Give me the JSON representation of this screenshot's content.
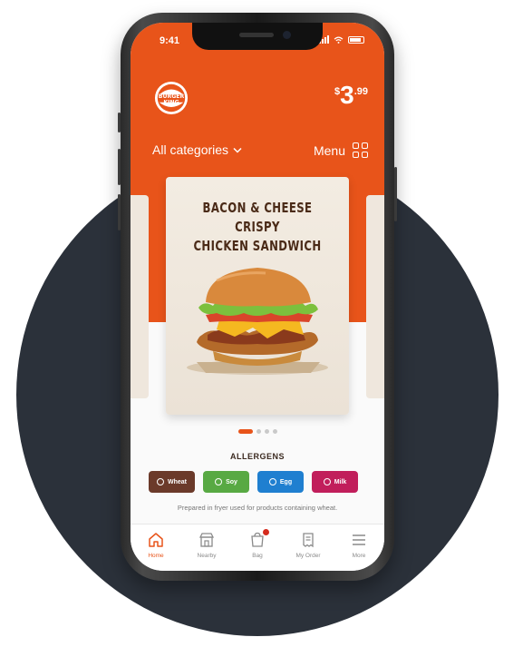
{
  "status_bar": {
    "time": "9:41"
  },
  "header": {
    "logo_text_1": "BURGER",
    "logo_text_2": "KING",
    "price_currency": "$",
    "price_integer": "3",
    "price_cents": ".99",
    "category_dropdown": "All categories",
    "menu_label": "Menu"
  },
  "product": {
    "title_line1": "BACON & CHEESE CRISPY",
    "title_line2": "CHICKEN SANDWICH"
  },
  "carousel": {
    "count": 4,
    "active_index": 0
  },
  "allergens": {
    "title": "ALLERGENS",
    "items": [
      {
        "label": "Wheat",
        "color": "#6b3a2a"
      },
      {
        "label": "Soy",
        "color": "#58a943"
      },
      {
        "label": "Egg",
        "color": "#1f7fd0"
      },
      {
        "label": "Milk",
        "color": "#c11e5b"
      }
    ],
    "note": "Prepared in fryer used for products containing wheat."
  },
  "tabbar": {
    "items": [
      {
        "label": "Home",
        "icon": "home-icon",
        "active": true
      },
      {
        "label": "Nearby",
        "icon": "store-icon",
        "active": false
      },
      {
        "label": "Bag",
        "icon": "bag-icon",
        "active": false
      },
      {
        "label": "My Order",
        "icon": "receipt-icon",
        "active": false
      },
      {
        "label": "More",
        "icon": "hamburger-menu-icon",
        "active": false
      }
    ]
  },
  "colors": {
    "brand_orange": "#e8541a",
    "background_circle": "#2b313a"
  }
}
